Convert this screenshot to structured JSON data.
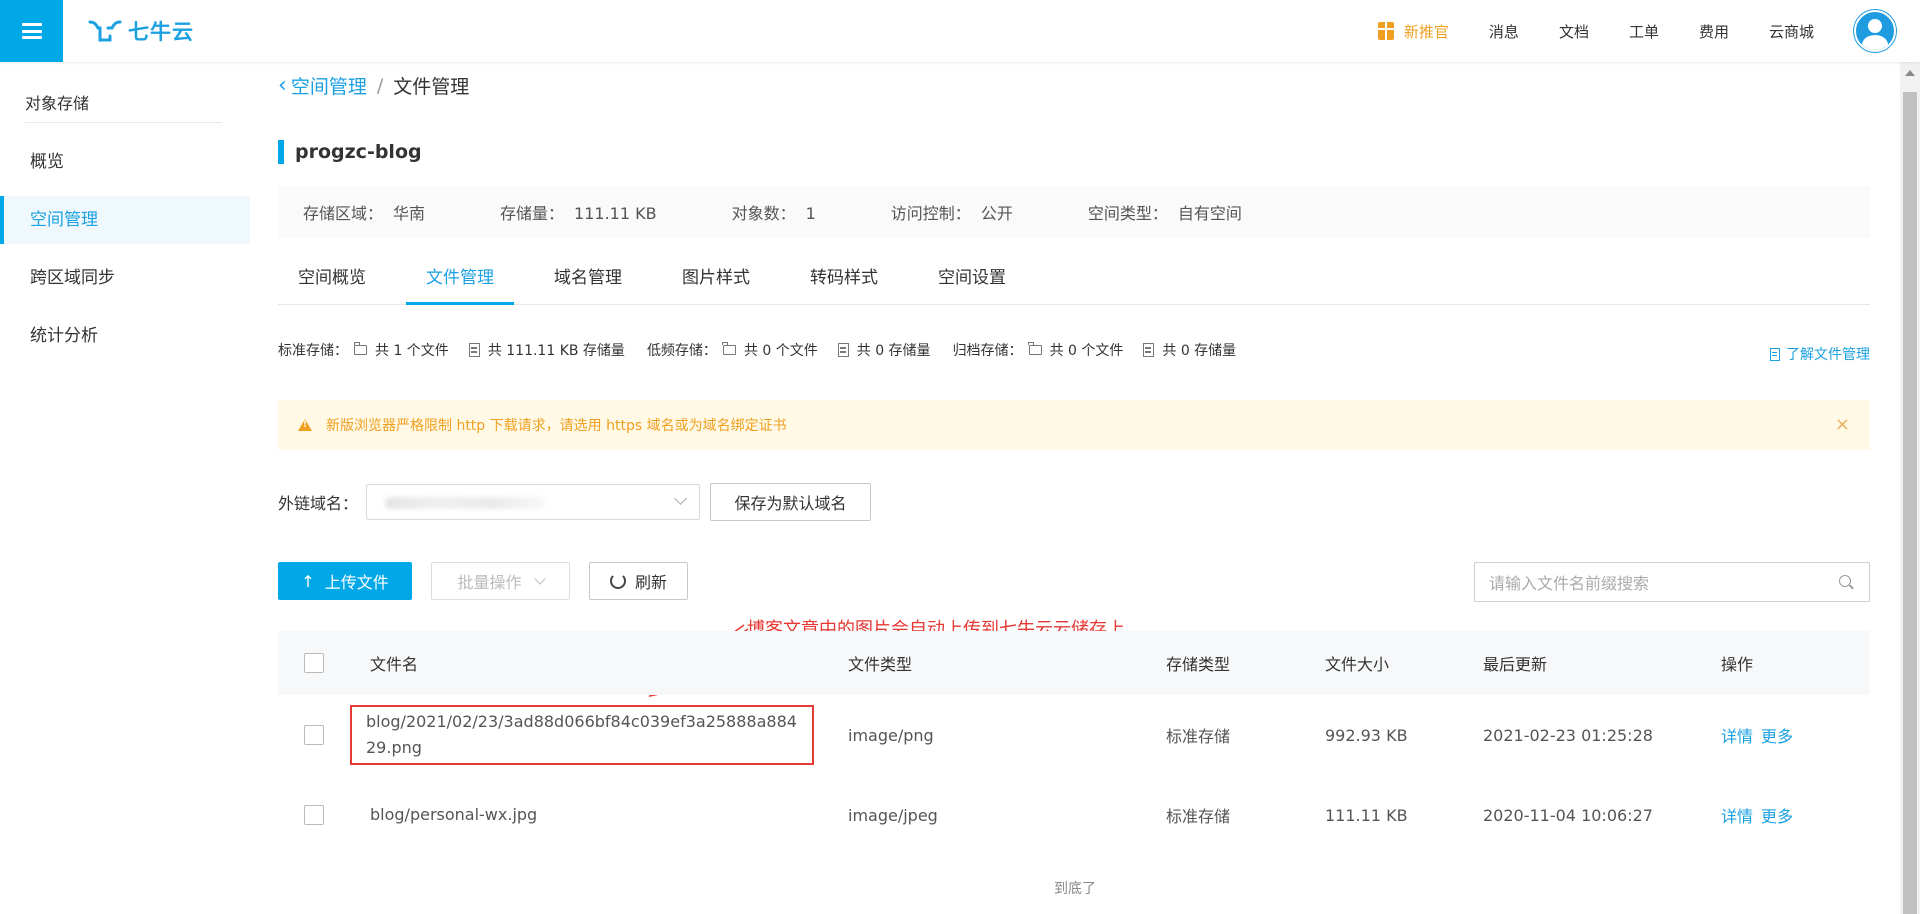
{
  "header": {
    "logo_text": "七牛云",
    "nav": {
      "promo": "新推官",
      "messages": "消息",
      "docs": "文档",
      "tickets": "工单",
      "billing": "费用",
      "marketplace": "云商城"
    }
  },
  "sidebar": {
    "title": "对象存储",
    "items": [
      {
        "label": "概览"
      },
      {
        "label": "空间管理"
      },
      {
        "label": "跨区域同步"
      },
      {
        "label": "统计分析"
      }
    ]
  },
  "breadcrumb": {
    "back": "空间管理",
    "separator": "/",
    "current": "文件管理"
  },
  "bucket": {
    "name": "progzc-blog",
    "info": {
      "region_label": "存储区域：",
      "region": "华南",
      "capacity_label": "存储量：",
      "capacity": "111.11 KB",
      "objects_label": "对象数：",
      "objects": "1",
      "access_label": "访问控制：",
      "access": "公开",
      "type_label": "空间类型：",
      "type": "自有空间"
    }
  },
  "tabs": [
    {
      "label": "空间概览"
    },
    {
      "label": "文件管理"
    },
    {
      "label": "域名管理"
    },
    {
      "label": "图片样式"
    },
    {
      "label": "转码样式"
    },
    {
      "label": "空间设置"
    }
  ],
  "stats": {
    "standard_label": "标准存储：",
    "standard_files": "共 1 个文件",
    "standard_size": "共 111.11 KB 存储量",
    "low_label": "低频存储：",
    "low_files": "共 0 个文件",
    "low_size": "共 0 存储量",
    "archive_label": "归档存储：",
    "archive_files": "共 0 个文件",
    "archive_size": "共 0 存储量",
    "learn_more": "了解文件管理"
  },
  "alert": {
    "message": "新版浏览器严格限制 http 下载请求，请选用 https 域名或为域名绑定证书",
    "close": "×"
  },
  "domain": {
    "label": "外链域名：",
    "save_button": "保存为默认域名"
  },
  "toolbar": {
    "upload": "上传文件",
    "upload_arrow": "↑",
    "batch": "批量操作",
    "refresh": "刷新",
    "search_placeholder": "请输入文件名前缀搜索"
  },
  "annotation": {
    "text": "博客文章中的图片会自动上传到七牛云云储存上",
    "color": "#e53935"
  },
  "table": {
    "headers": {
      "name": "文件名",
      "type": "文件类型",
      "storage": "存储类型",
      "size": "文件大小",
      "updated": "最后更新",
      "ops": "操作"
    },
    "rows": [
      {
        "name": "blog/2021/02/23/3ad88d066bf84c039ef3a25888a88429.png",
        "type": "image/png",
        "storage": "标准存储",
        "size": "992.93 KB",
        "updated": "2021-02-23 01:25:28",
        "detail": "详情",
        "more": "更多"
      },
      {
        "name": "blog/personal-wx.jpg",
        "type": "image/jpeg",
        "storage": "标准存储",
        "size": "111.11 KB",
        "updated": "2020-11-04 10:06:27",
        "detail": "详情",
        "more": "更多"
      }
    ]
  },
  "footer_tip": "到底了",
  "colors": {
    "accent": "#00a8e8",
    "warning": "#f0a020",
    "annotation": "#e53935"
  }
}
